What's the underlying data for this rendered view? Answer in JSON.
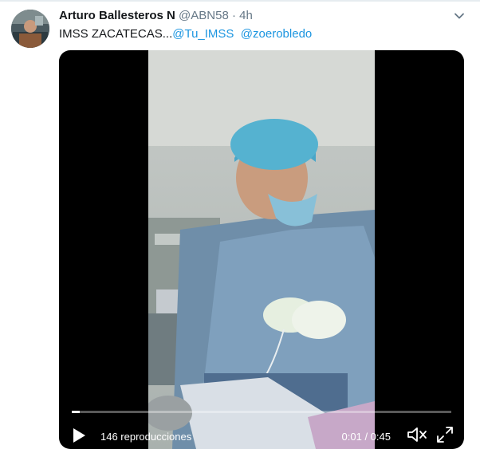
{
  "tweet": {
    "author_name": "Arturo Ballesteros N",
    "handle": "@ABN58",
    "separator": "·",
    "time": "4h",
    "text_prefix": "IMSS ZACATECAS...",
    "mentions": [
      "@Tu_IMSS",
      "@zoerobledo"
    ]
  },
  "video": {
    "progress_percent": 2,
    "views": "146 reproducciones",
    "timecode": "0:01 / 0:45"
  },
  "icons": {
    "caret": "chevron-down-icon",
    "play": "play-icon",
    "mute": "speaker-muted-icon",
    "fullscreen": "fullscreen-icon"
  },
  "colors": {
    "link": "#1b95e0",
    "text": "#14171a",
    "muted": "#657786",
    "video_bg": "#000000"
  }
}
